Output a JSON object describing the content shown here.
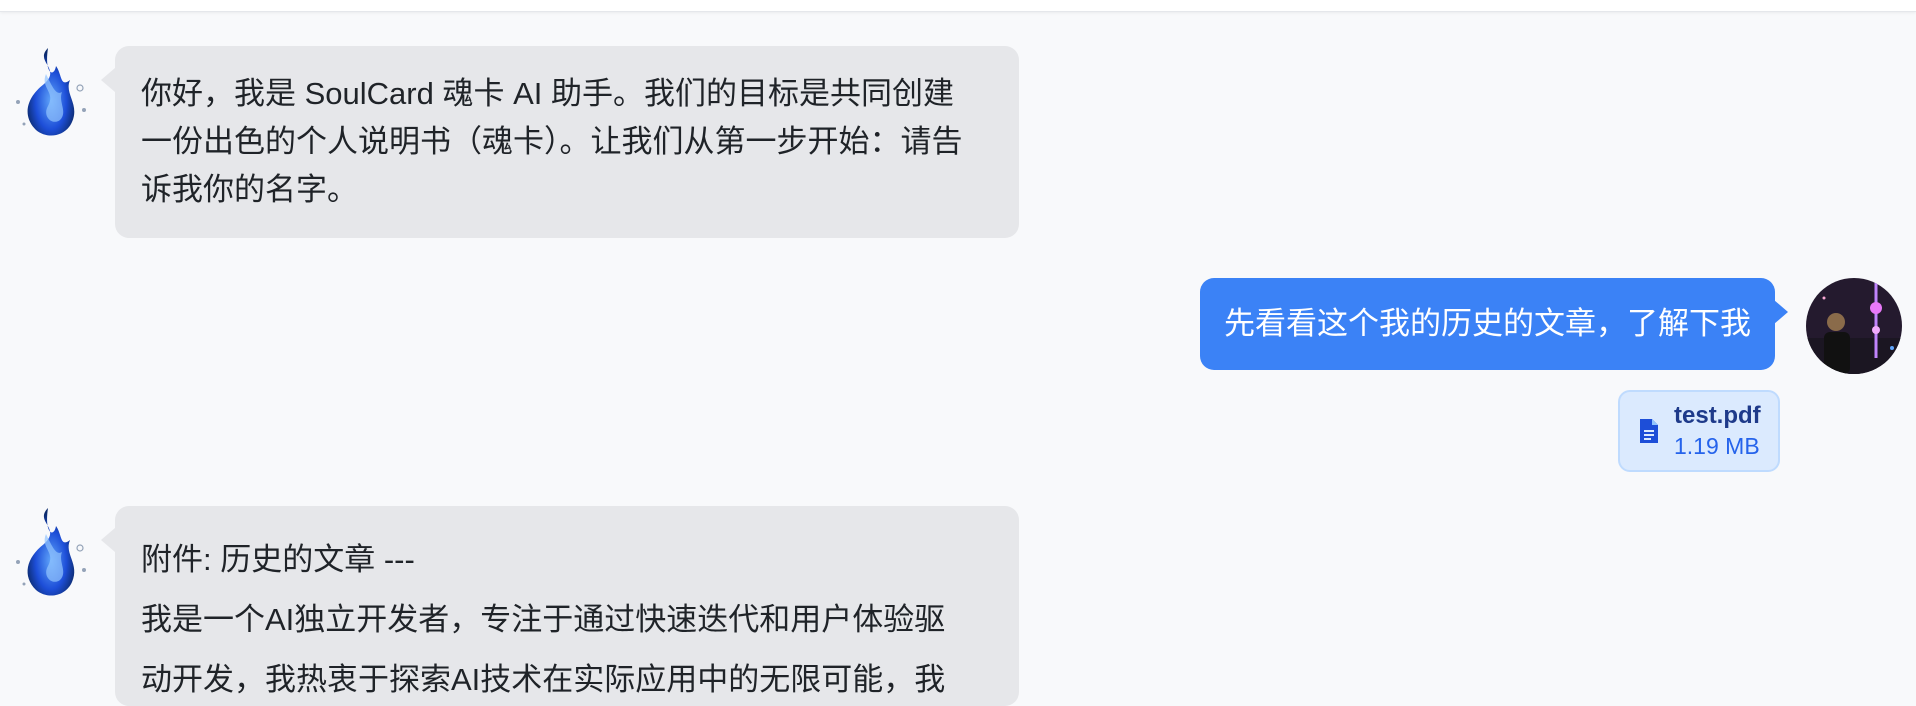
{
  "messages": {
    "ai_1": {
      "lines": [
        "你好，我是 SoulCard 魂卡 AI 助手。我们的目标是共同创建",
        "一份出色的个人说明书（魂卡）。让我们从第一步开始：请告",
        "诉我你的名字。"
      ]
    },
    "user_1": {
      "text": "先看看这个我的历史的文章，了解下我",
      "attachment": {
        "name": "test.pdf",
        "size": "1.19 MB",
        "icon": "document-icon"
      }
    },
    "ai_2": {
      "title": "附件: 历史的文章 ---",
      "lines": [
        "我是一个AI独立开发者，专注于通过快速迭代和用户体验驱",
        "动开发，我热衷于探索AI技术在实际应用中的无限可能，我"
      ]
    }
  },
  "colors": {
    "user_bubble": "#3b82f6",
    "ai_bubble": "#e6e7ea",
    "background": "#f8f9fb",
    "file_chip_bg": "#dbeafe"
  }
}
